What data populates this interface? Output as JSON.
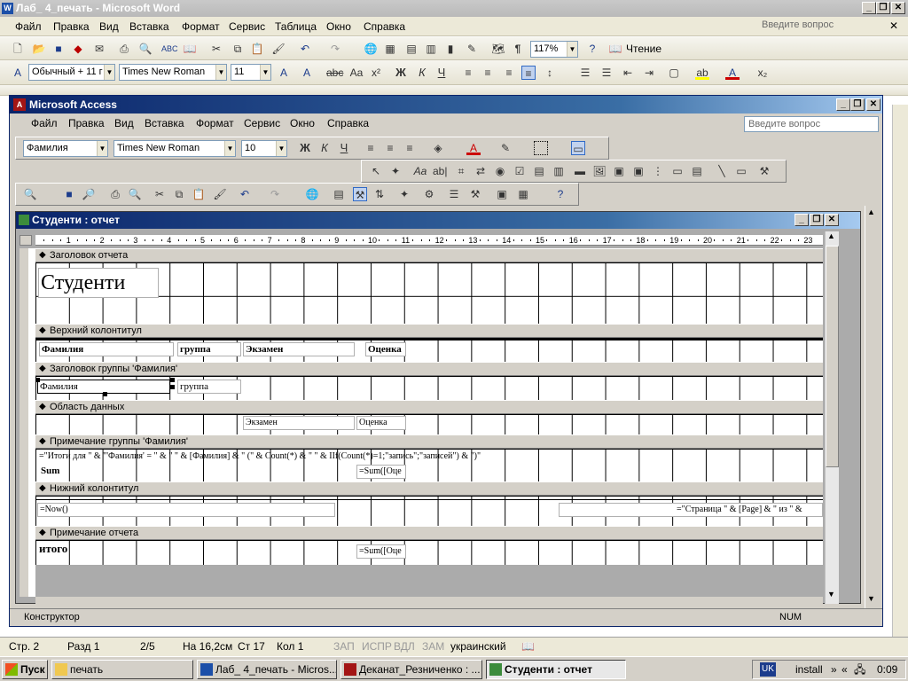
{
  "word": {
    "title": "Лаб_ 4_печать - Microsoft Word",
    "menu": [
      "Файл",
      "Правка",
      "Вид",
      "Вставка",
      "Формат",
      "Сервис",
      "Таблица",
      "Окно",
      "Справка"
    ],
    "help_placeholder": "Введите вопрос",
    "zoom": "117%",
    "reading_label": "Чтение",
    "style": "Обычный + 11 г",
    "font": "Times New Roman",
    "size": "11",
    "bold": "Ж",
    "italic": "К",
    "underline": "Ч",
    "status": {
      "page": "Стр. 2",
      "section": "Разд 1",
      "pages": "2/5",
      "at": "На 16,2см",
      "line": "Ст 17",
      "col": "Кол 1",
      "rec": "ЗАП",
      "trk": "ИСПР",
      "ext": "ВДЛ",
      "ovr": "ЗАМ",
      "lang": "украинский"
    }
  },
  "access": {
    "title": "Microsoft Access",
    "menu": [
      "Файл",
      "Правка",
      "Вид",
      "Вставка",
      "Формат",
      "Сервис",
      "Окно",
      "Справка"
    ],
    "help_placeholder": "Введите вопрос",
    "object": "Фамилия",
    "font": "Times New Roman",
    "size": "10",
    "bold": "Ж",
    "italic": "К",
    "underline": "Ч",
    "status_mode": "Конструктор",
    "status_num": "NUM"
  },
  "report": {
    "title": "Студенти : отчет",
    "ruler": [
      "1",
      "2",
      "3",
      "4",
      "5",
      "6",
      "7",
      "8",
      "9",
      "10",
      "11",
      "12",
      "13",
      "14",
      "15",
      "16",
      "17",
      "18",
      "19",
      "20",
      "21",
      "22",
      "23"
    ],
    "sections": {
      "report_header": "Заголовок отчета",
      "page_header": "Верхний колонтитул",
      "group_header": "Заголовок группы 'Фамилия'",
      "detail": "Область данных",
      "group_footer": "Примечание группы 'Фамилия'",
      "page_footer": "Нижний колонтитул",
      "report_footer": "Примечание отчета"
    },
    "controls": {
      "report_title": "Студенти",
      "ph_surname": "Фамилия",
      "ph_group": "группа",
      "ph_exam": "Экзамен",
      "ph_grade": "Оценка",
      "gh_surname": "Фамилия",
      "gh_group": "группа",
      "d_exam": "Экзамен",
      "d_grade": "Оценка",
      "gf_summary": "=\"Итоги для \" & \"'Фамилия' = \" & \" \" & [Фамилия] & \" (\" & Count(*) & \" \" & IIf(Count(*)=1;\"запись\";\"записей\") & \")\"",
      "gf_sum_label": "Sum",
      "gf_sum_expr": "=Sum([Оце",
      "pf_now": "=Now()",
      "pf_page": "=\"Страница \" & [Page] & \" из \" &",
      "rf_label": "итого",
      "rf_sum_expr": "=Sum([Оце"
    }
  },
  "taskbar": {
    "start": "Пуск",
    "tasks": [
      "печать",
      "Лаб_ 4_печать - Micros...",
      "Деканат_Резниченко : ...",
      "Студенти : отчет"
    ],
    "lang": "UK",
    "tray_label": "install",
    "time": "0:09"
  }
}
